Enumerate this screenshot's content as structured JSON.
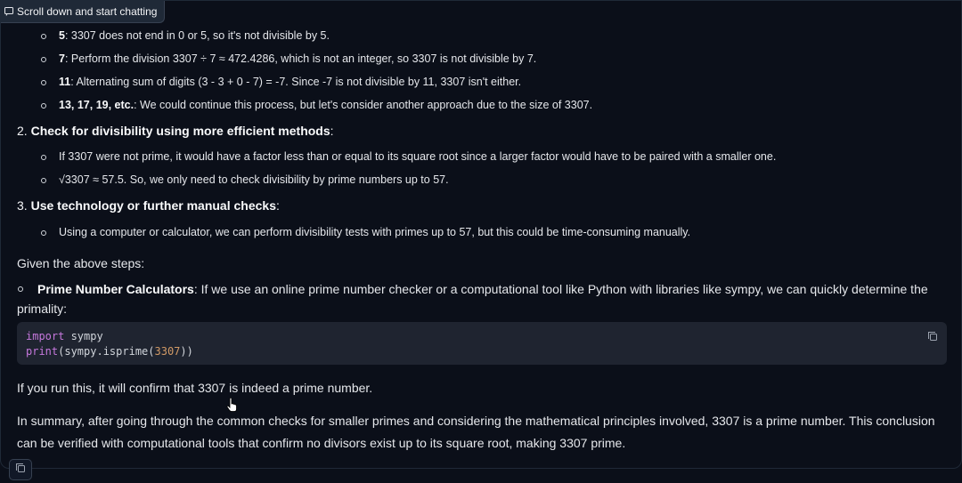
{
  "banner": {
    "label": "Scroll down and start chatting",
    "icon": "chat-bubble-icon"
  },
  "sub_items_top": [
    {
      "num": "5",
      "text": ": 3307 does not end in 0 or 5, so it's not divisible by 5."
    },
    {
      "num": "7",
      "text": ": Perform the division 3307 ÷ 7 ≈ 472.4286, which is not an integer, so 3307 is not divisible by 7."
    },
    {
      "num": "11",
      "text": ": Alternating sum of digits (3 - 3 + 0 - 7) = -7. Since -7 is not divisible by 11, 3307 isn't either."
    },
    {
      "num": "13, 17, 19, etc.",
      "text": ": We could continue this process, but let's consider another approach due to the size of 3307."
    }
  ],
  "step2": {
    "prefix": "2. ",
    "title": "Check for divisibility using more efficient methods",
    "suffix": ":",
    "items": [
      "If 3307 were not prime, it would have a factor less than or equal to its square root since a larger factor would have to be paired with a smaller one.",
      "√3307 ≈ 57.5. So, we only need to check divisibility by prime numbers up to 57."
    ]
  },
  "step3": {
    "prefix": "3. ",
    "title": "Use technology or further manual checks",
    "suffix": ":",
    "items": [
      "Using a computer or calculator, we can perform divisibility tests with primes up to 57, but this could be time-consuming manually."
    ]
  },
  "given": "Given the above steps:",
  "prime_calc": {
    "title": "Prime Number Calculators",
    "text": ": If we use an online prime number checker or a computational tool like Python with libraries like sympy, we can quickly determine the primality:"
  },
  "code": {
    "line1_kw": "import",
    "line1_rest": " sympy",
    "line2_fn": "print",
    "line2_mid": "(sympy.isprime(",
    "line2_num": "3307",
    "line2_end": "))"
  },
  "confirm": "If you run this, it will confirm that 3307 is indeed a prime number.",
  "summary": "In summary, after going through the common checks for smaller primes and considering the mathematical principles involved, 3307 is a prime number. This conclusion can be verified with computational tools that confirm no divisors exist up to its square root, making 3307 prime.",
  "colors": {
    "background": "#0b0f19",
    "code_background": "#1f2430",
    "keyword": "#c678dd",
    "number": "#d19a66"
  }
}
